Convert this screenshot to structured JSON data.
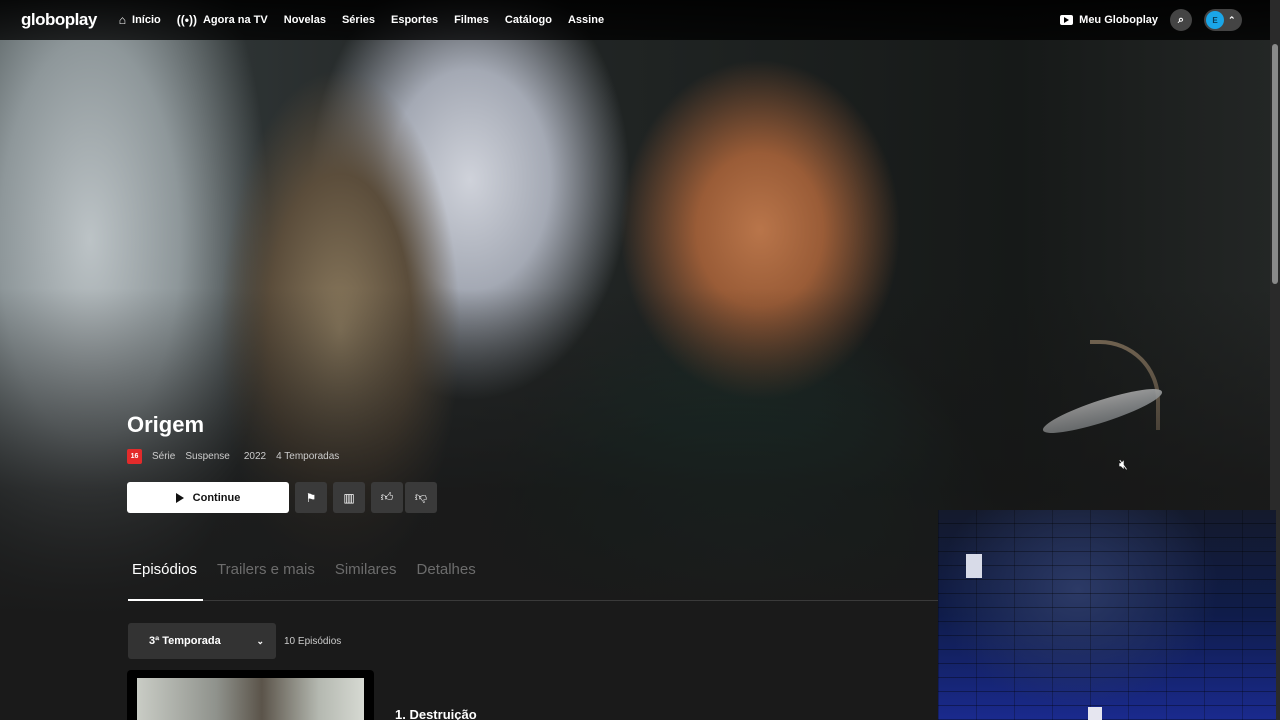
{
  "header": {
    "logo": "globoplay",
    "nav": [
      {
        "label": "Início",
        "icon": "home-icon"
      },
      {
        "label": "Agora na TV",
        "icon": "broadcast-icon"
      },
      {
        "label": "Novelas"
      },
      {
        "label": "Séries"
      },
      {
        "label": "Esportes"
      },
      {
        "label": "Filmes"
      },
      {
        "label": "Catálogo"
      },
      {
        "label": "Assine"
      }
    ],
    "meu_globoplay": "Meu Globoplay",
    "avatar_initial": "E"
  },
  "title": {
    "name": "Origem",
    "rating": "16",
    "type": "Série",
    "genre": "Suspense",
    "year": "2022",
    "seasons": "4 Temporadas"
  },
  "actions": {
    "continue_label": "Continue"
  },
  "tabs": [
    {
      "label": "Episódios",
      "active": true
    },
    {
      "label": "Trailers e mais"
    },
    {
      "label": "Similares"
    },
    {
      "label": "Detalhes"
    }
  ],
  "season": {
    "selected": "3ª Temporada",
    "episode_count": "10 Episódios"
  },
  "episodes": [
    {
      "title": "1. Destruição"
    }
  ],
  "colors": {
    "rating_badge": "#e32b2b",
    "avatar": "#1aa6e8"
  }
}
